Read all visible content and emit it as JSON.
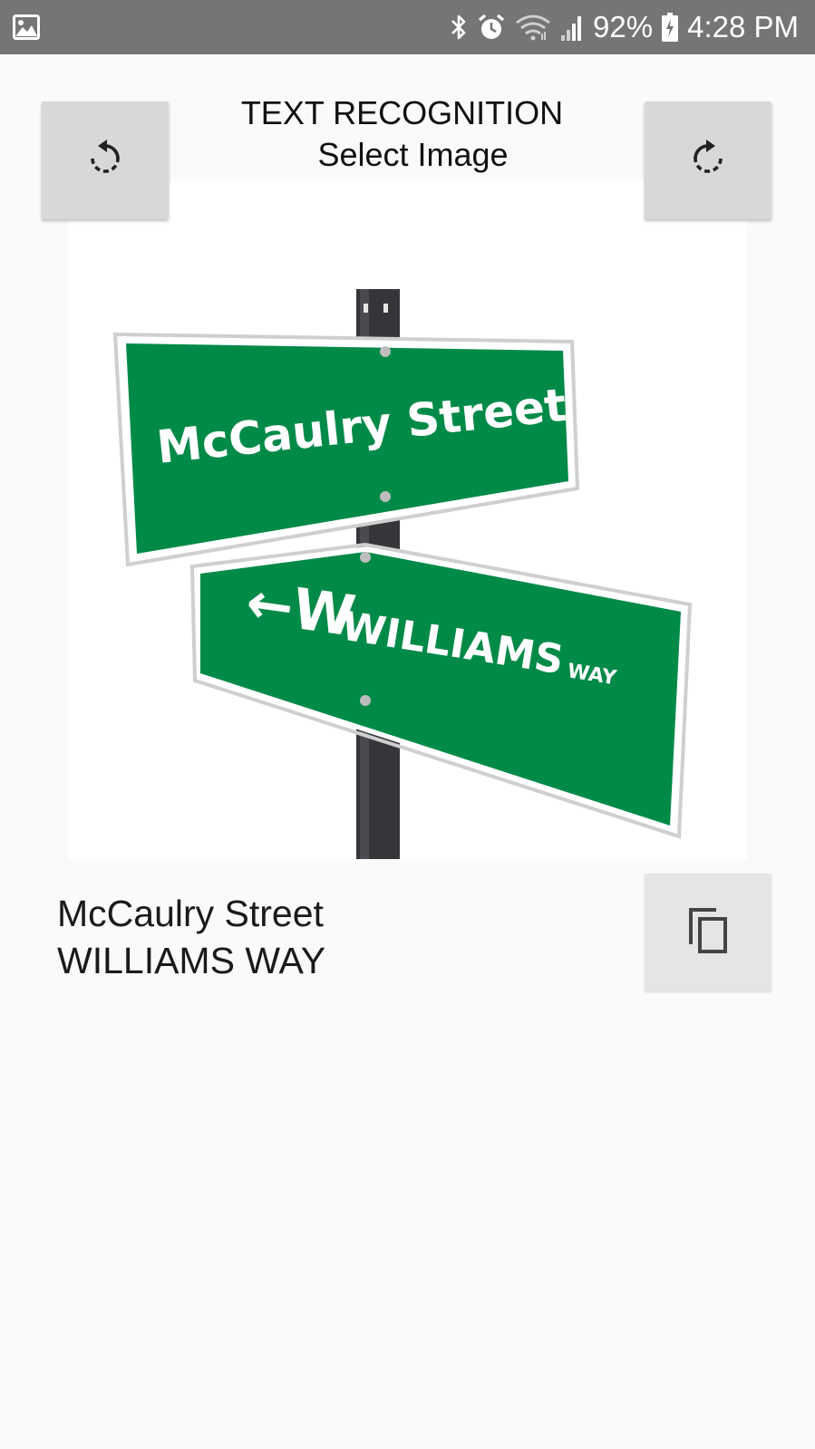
{
  "status_bar": {
    "battery_percent": "92%",
    "time": "4:28 PM",
    "icons": [
      "gallery-icon",
      "bluetooth-icon",
      "alarm-icon",
      "wifi-icon",
      "signal-icon",
      "battery-charging-icon"
    ]
  },
  "header": {
    "title": "TEXT RECOGNITION",
    "select_label": "Select Image"
  },
  "buttons": {
    "rotate_left_icon": "rotate-left-icon",
    "rotate_right_icon": "rotate-right-icon",
    "copy_icon": "copy-icon"
  },
  "image": {
    "sign_top": "McCaulry Street",
    "sign_bottom_main": "WILLIAMS",
    "sign_bottom_suffix": "WAY",
    "sign_color": "#008a48"
  },
  "result": {
    "line1": "McCaulry Street",
    "line2": "WILLIAMS WAY"
  },
  "colors": {
    "status_bar": "#757575",
    "background": "#fafafa",
    "button": "#d8d8d8"
  }
}
